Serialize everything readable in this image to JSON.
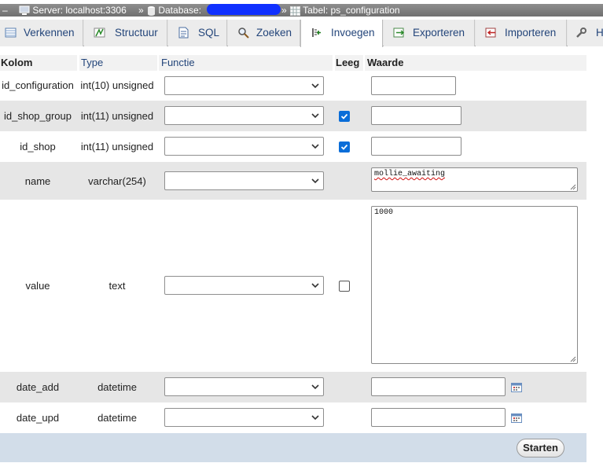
{
  "breadcrumb": {
    "server": "Server: localhost:3306",
    "sep1": "»",
    "database": "Database:",
    "sep2": "»",
    "table": "Tabel: ps_configuration"
  },
  "tabs": [
    {
      "label": "Verkennen",
      "icon": "browse-icon"
    },
    {
      "label": "Structuur",
      "icon": "structure-icon"
    },
    {
      "label": "SQL",
      "icon": "sql-icon"
    },
    {
      "label": "Zoeken",
      "icon": "search-icon"
    },
    {
      "label": "Invoegen",
      "icon": "insert-icon",
      "active": true
    },
    {
      "label": "Exporteren",
      "icon": "export-icon"
    },
    {
      "label": "Importeren",
      "icon": "import-icon"
    },
    {
      "label": "H",
      "icon": "wrench-icon"
    }
  ],
  "columns": {
    "kolom": "Kolom",
    "type": "Type",
    "functie": "Functie",
    "leeg": "Leeg",
    "waarde": "Waarde"
  },
  "rows": [
    {
      "name": "id_configuration",
      "type": "int(10) unsigned",
      "function": "",
      "null_checked": false,
      "null_visible": false,
      "value": ""
    },
    {
      "name": "id_shop_group",
      "type": "int(11) unsigned",
      "function": "",
      "null_checked": true,
      "null_visible": true,
      "value": ""
    },
    {
      "name": "id_shop",
      "type": "int(11) unsigned",
      "function": "",
      "null_checked": true,
      "null_visible": true,
      "value": ""
    },
    {
      "name": "name",
      "type": "varchar(254)",
      "function": "",
      "null_checked": false,
      "null_visible": false,
      "value": "mollie_awaiting"
    },
    {
      "name": "value",
      "type": "text",
      "function": "",
      "null_checked": false,
      "null_visible": true,
      "value": "1000"
    },
    {
      "name": "date_add",
      "type": "datetime",
      "function": "",
      "null_checked": false,
      "null_visible": false,
      "value": ""
    },
    {
      "name": "date_upd",
      "type": "datetime",
      "function": "",
      "null_checked": false,
      "null_visible": false,
      "value": ""
    }
  ],
  "footer": {
    "go_label": "Starten"
  },
  "colors": {
    "accent": "#23457a",
    "checkbox": "#0a6dd8",
    "row_shade": "#e6e6e6",
    "footer": "#d2dde9"
  }
}
